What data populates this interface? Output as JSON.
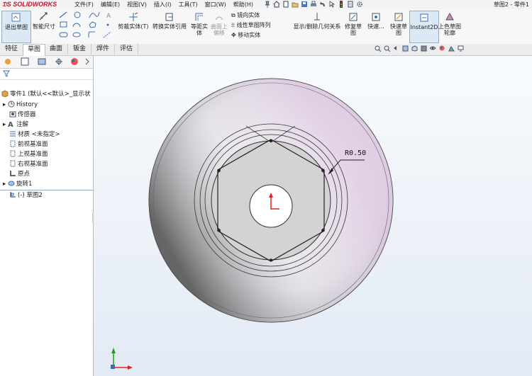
{
  "app": {
    "logo": "SOLIDWORKS",
    "title_right": "草图2 - 零件1"
  },
  "menu": [
    "文件(F)",
    "编辑(E)",
    "视图(V)",
    "插入(I)",
    "工具(T)",
    "窗口(W)",
    "帮助(H)"
  ],
  "ribbon": {
    "exit_sketch": "退出草图",
    "smart_dim": "智能尺寸",
    "trim": "剪裁实体(T)",
    "convert": "转换实体引用",
    "offset": "等距实体",
    "surface_offset": "曲面上偏移",
    "mirror": "镜向实体",
    "linear_pattern": "线性草图阵列",
    "move": "移动实体",
    "display_relations": "显示/删除几何关系",
    "repair": "修复草图",
    "quick_snaps": "快速...",
    "rapid_sketch": "快速草图",
    "instant2d": "Instant2D",
    "shaded_contours": "上色草图轮廓"
  },
  "tabs": [
    "特征",
    "草图",
    "曲面",
    "钣金",
    "焊件",
    "评估"
  ],
  "active_tab": "草图",
  "tree": {
    "root": "零件1 (默认<<默认>_显示状",
    "items": [
      "History",
      "传感器",
      "注解",
      "材质 <未指定>",
      "前视基准面",
      "上视基准面",
      "右视基准面",
      "原点",
      "旋转1",
      "(-) 草图2"
    ]
  },
  "annotation": {
    "radius": "R0.50"
  },
  "colors": {
    "accent": "#c8102e",
    "selection": "#d8e8f8"
  }
}
